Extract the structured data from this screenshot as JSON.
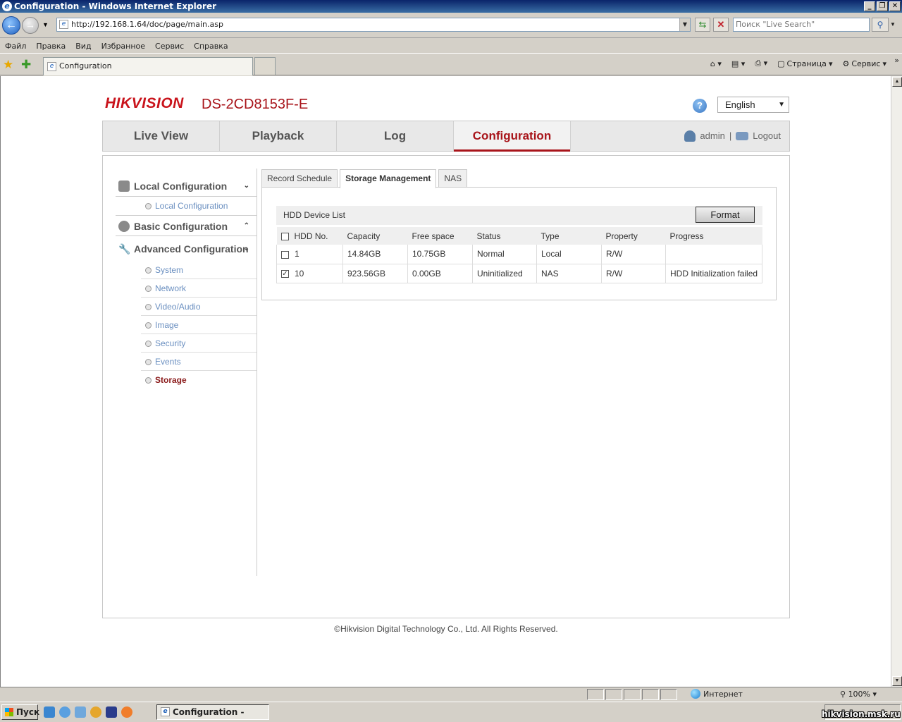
{
  "window": {
    "title": "Configuration - Windows Internet Explorer"
  },
  "address_bar": {
    "url": "http://192.168.1.64/doc/page/main.asp",
    "search_placeholder": "Поиск \"Live Search\""
  },
  "menu": [
    "Файл",
    "Правка",
    "Вид",
    "Избранное",
    "Сервис",
    "Справка"
  ],
  "favorites_bar": {
    "tab_title": "Configuration",
    "page_label": "Страница",
    "tools_label": "Сервис"
  },
  "page": {
    "logo": "HIKVISION",
    "model": "DS-2CD8153F-E",
    "language": "English",
    "nav_tabs": [
      "Live View",
      "Playback",
      "Log",
      "Configuration"
    ],
    "active_nav": "Configuration",
    "user": "admin",
    "separator": "|",
    "logout": "Logout",
    "sidebar": {
      "local_configuration": "Local Configuration",
      "local_items": [
        "Local Configuration"
      ],
      "basic_configuration": "Basic Configuration",
      "advanced_configuration": "Advanced Configuration",
      "advanced_items": [
        "System",
        "Network",
        "Video/Audio",
        "Image",
        "Security",
        "Events",
        "Storage"
      ],
      "active_item": "Storage"
    },
    "sub_tabs": [
      "Record Schedule",
      "Storage Management",
      "NAS"
    ],
    "active_sub_tab": "Storage Management",
    "hdd": {
      "list_title": "HDD Device List",
      "format_button": "Format",
      "columns": [
        "HDD No.",
        "Capacity",
        "Free space",
        "Status",
        "Type",
        "Property",
        "Progress"
      ],
      "rows": [
        {
          "checked": false,
          "no": "1",
          "capacity": "14.84GB",
          "free": "10.75GB",
          "status": "Normal",
          "type": "Local",
          "property": "R/W",
          "progress": ""
        },
        {
          "checked": true,
          "no": "10",
          "capacity": "923.56GB",
          "free": "0.00GB",
          "status": "Uninitialized",
          "type": "NAS",
          "property": "R/W",
          "progress": "HDD Initialization failed"
        }
      ]
    },
    "footer": "©Hikvision Digital Technology Co., Ltd. All Rights Reserved."
  },
  "status_bar": {
    "zone": "Интернет",
    "zoom": "100%"
  },
  "taskbar": {
    "start": "Пуск",
    "task": "Configuration - Windo..."
  },
  "watermark": "hikvision.msk.ru"
}
